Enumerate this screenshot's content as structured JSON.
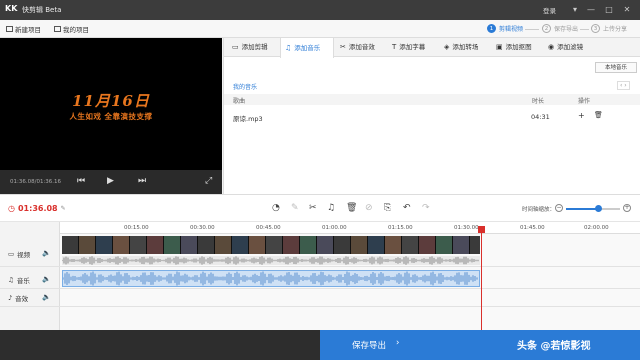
{
  "titlebar": {
    "logo": "KK",
    "title": "快剪辑 Beta",
    "login": "登录",
    "min": "—",
    "max": "□",
    "close": "✕"
  },
  "menubar": {
    "new_project": "新建项目",
    "my_projects": "我的项目",
    "steps": [
      {
        "num": "1",
        "label": "剪辑视频"
      },
      {
        "num": "2",
        "label": "保存导出"
      },
      {
        "num": "3",
        "label": "上传分享"
      }
    ]
  },
  "preview": {
    "big_text": "11月16日",
    "sub_text": "人生如戏  全靠演技支撑",
    "time": "01:36.08/01:36.16"
  },
  "tabs": [
    {
      "label": "添加剪辑",
      "icon": "▭"
    },
    {
      "label": "添加音乐",
      "icon": "♫"
    },
    {
      "label": "添加音效",
      "icon": "✂"
    },
    {
      "label": "添加字幕",
      "icon": "T"
    },
    {
      "label": "添加转场",
      "icon": "◈"
    },
    {
      "label": "添加抠图",
      "icon": "▣"
    },
    {
      "label": "添加滤镜",
      "icon": "◉"
    }
  ],
  "music": {
    "local_button": "本地音乐",
    "section": "我的音乐",
    "nav": "‹ ›",
    "headers": {
      "song": "歌曲",
      "duration": "时长",
      "action": "操作"
    },
    "rows": [
      {
        "song": "原谅.mp3",
        "duration": "04:31"
      }
    ]
  },
  "timeline": {
    "current_time": "01:36.08",
    "zoom_label": "时间轴缩放：",
    "zoom_level": 0.6,
    "ticks": [
      "00:15.00",
      "00:30.00",
      "00:45.00",
      "01:00.00",
      "01:15.00",
      "01:30.00",
      "01:45.00",
      "02:00.00"
    ],
    "tracks": [
      {
        "label": "视频",
        "icon": "▭"
      },
      {
        "label": "音乐",
        "icon": "♫"
      },
      {
        "label": "音效",
        "icon": "♪"
      }
    ]
  },
  "bottom": {
    "save_export": "保存导出",
    "watermark": "头条 @若惊影视"
  },
  "colors": {
    "accent": "#2b7bd6",
    "playhead": "#d9302c",
    "preview_text": "#e8761e"
  }
}
